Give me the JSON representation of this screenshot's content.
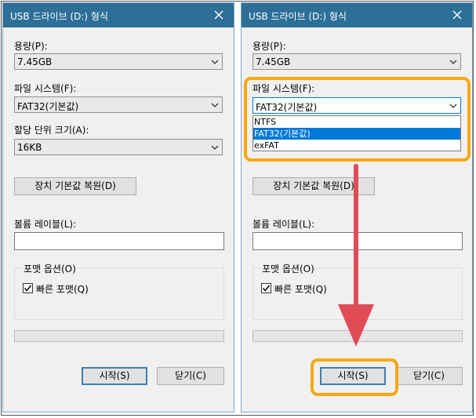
{
  "dialogs": [
    {
      "title": "USB 드라이브 (D:) 형식",
      "capacity_label": "용량(P):",
      "capacity_value": "7.45GB",
      "fs_label": "파일 시스템(F):",
      "fs_value": "FAT32(기본값)",
      "alloc_label": "할당 단위 크기(A):",
      "alloc_value": "16KB",
      "restore_button": "장치 기본값 복원(D)",
      "volume_label": "볼륨 레이블(L):",
      "volume_value": "",
      "format_options_label": "포맷 옵션(O)",
      "quick_format_label": "빠른 포맷(Q)",
      "quick_format_checked": true,
      "start_button": "시작(S)",
      "close_button": "닫기(C)"
    },
    {
      "title": "USB 드라이브 (D:) 형식",
      "capacity_label": "용량(P):",
      "capacity_value": "7.45GB",
      "fs_label": "파일 시스템(F):",
      "fs_value": "FAT32(기본값)",
      "fs_options": [
        "NTFS",
        "FAT32(기본값)",
        "exFAT"
      ],
      "fs_selected_index": 1,
      "restore_button": "장치 기본값 복원(D)",
      "volume_label": "볼륨 레이블(L):",
      "volume_value": "",
      "format_options_label": "포맷 옵션(O)",
      "quick_format_label": "빠른 포맷(Q)",
      "quick_format_checked": true,
      "start_button": "시작(S)",
      "close_button": "닫기(C)"
    }
  ],
  "colors": {
    "titlebar": "#2d6f97",
    "highlight": "#f5a815",
    "arrow": "#e04c55",
    "selection": "#0078d7"
  }
}
